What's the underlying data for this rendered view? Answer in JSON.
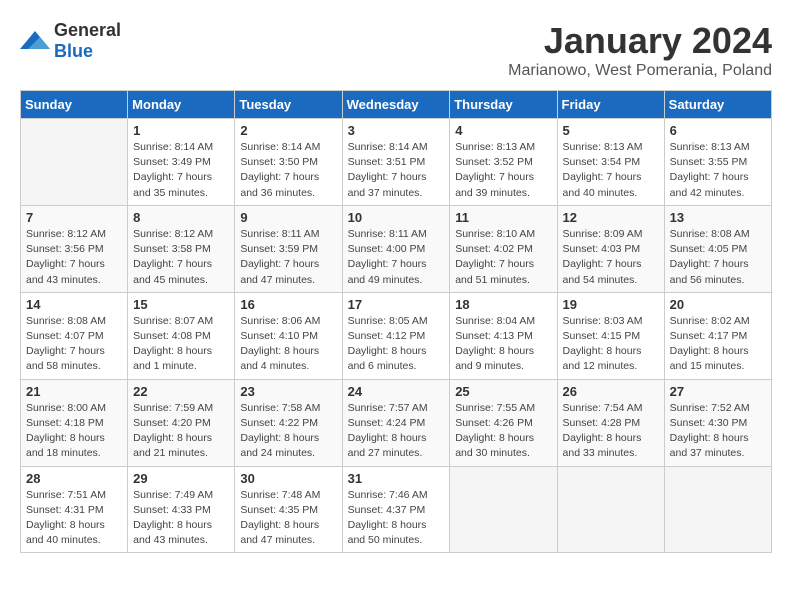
{
  "header": {
    "logo_general": "General",
    "logo_blue": "Blue",
    "month": "January 2024",
    "location": "Marianowo, West Pomerania, Poland"
  },
  "weekdays": [
    "Sunday",
    "Monday",
    "Tuesday",
    "Wednesday",
    "Thursday",
    "Friday",
    "Saturday"
  ],
  "weeks": [
    [
      {
        "day": "",
        "info": ""
      },
      {
        "day": "1",
        "info": "Sunrise: 8:14 AM\nSunset: 3:49 PM\nDaylight: 7 hours\nand 35 minutes."
      },
      {
        "day": "2",
        "info": "Sunrise: 8:14 AM\nSunset: 3:50 PM\nDaylight: 7 hours\nand 36 minutes."
      },
      {
        "day": "3",
        "info": "Sunrise: 8:14 AM\nSunset: 3:51 PM\nDaylight: 7 hours\nand 37 minutes."
      },
      {
        "day": "4",
        "info": "Sunrise: 8:13 AM\nSunset: 3:52 PM\nDaylight: 7 hours\nand 39 minutes."
      },
      {
        "day": "5",
        "info": "Sunrise: 8:13 AM\nSunset: 3:54 PM\nDaylight: 7 hours\nand 40 minutes."
      },
      {
        "day": "6",
        "info": "Sunrise: 8:13 AM\nSunset: 3:55 PM\nDaylight: 7 hours\nand 42 minutes."
      }
    ],
    [
      {
        "day": "7",
        "info": "Sunrise: 8:12 AM\nSunset: 3:56 PM\nDaylight: 7 hours\nand 43 minutes."
      },
      {
        "day": "8",
        "info": "Sunrise: 8:12 AM\nSunset: 3:58 PM\nDaylight: 7 hours\nand 45 minutes."
      },
      {
        "day": "9",
        "info": "Sunrise: 8:11 AM\nSunset: 3:59 PM\nDaylight: 7 hours\nand 47 minutes."
      },
      {
        "day": "10",
        "info": "Sunrise: 8:11 AM\nSunset: 4:00 PM\nDaylight: 7 hours\nand 49 minutes."
      },
      {
        "day": "11",
        "info": "Sunrise: 8:10 AM\nSunset: 4:02 PM\nDaylight: 7 hours\nand 51 minutes."
      },
      {
        "day": "12",
        "info": "Sunrise: 8:09 AM\nSunset: 4:03 PM\nDaylight: 7 hours\nand 54 minutes."
      },
      {
        "day": "13",
        "info": "Sunrise: 8:08 AM\nSunset: 4:05 PM\nDaylight: 7 hours\nand 56 minutes."
      }
    ],
    [
      {
        "day": "14",
        "info": "Sunrise: 8:08 AM\nSunset: 4:07 PM\nDaylight: 7 hours\nand 58 minutes."
      },
      {
        "day": "15",
        "info": "Sunrise: 8:07 AM\nSunset: 4:08 PM\nDaylight: 8 hours\nand 1 minute."
      },
      {
        "day": "16",
        "info": "Sunrise: 8:06 AM\nSunset: 4:10 PM\nDaylight: 8 hours\nand 4 minutes."
      },
      {
        "day": "17",
        "info": "Sunrise: 8:05 AM\nSunset: 4:12 PM\nDaylight: 8 hours\nand 6 minutes."
      },
      {
        "day": "18",
        "info": "Sunrise: 8:04 AM\nSunset: 4:13 PM\nDaylight: 8 hours\nand 9 minutes."
      },
      {
        "day": "19",
        "info": "Sunrise: 8:03 AM\nSunset: 4:15 PM\nDaylight: 8 hours\nand 12 minutes."
      },
      {
        "day": "20",
        "info": "Sunrise: 8:02 AM\nSunset: 4:17 PM\nDaylight: 8 hours\nand 15 minutes."
      }
    ],
    [
      {
        "day": "21",
        "info": "Sunrise: 8:00 AM\nSunset: 4:18 PM\nDaylight: 8 hours\nand 18 minutes."
      },
      {
        "day": "22",
        "info": "Sunrise: 7:59 AM\nSunset: 4:20 PM\nDaylight: 8 hours\nand 21 minutes."
      },
      {
        "day": "23",
        "info": "Sunrise: 7:58 AM\nSunset: 4:22 PM\nDaylight: 8 hours\nand 24 minutes."
      },
      {
        "day": "24",
        "info": "Sunrise: 7:57 AM\nSunset: 4:24 PM\nDaylight: 8 hours\nand 27 minutes."
      },
      {
        "day": "25",
        "info": "Sunrise: 7:55 AM\nSunset: 4:26 PM\nDaylight: 8 hours\nand 30 minutes."
      },
      {
        "day": "26",
        "info": "Sunrise: 7:54 AM\nSunset: 4:28 PM\nDaylight: 8 hours\nand 33 minutes."
      },
      {
        "day": "27",
        "info": "Sunrise: 7:52 AM\nSunset: 4:30 PM\nDaylight: 8 hours\nand 37 minutes."
      }
    ],
    [
      {
        "day": "28",
        "info": "Sunrise: 7:51 AM\nSunset: 4:31 PM\nDaylight: 8 hours\nand 40 minutes."
      },
      {
        "day": "29",
        "info": "Sunrise: 7:49 AM\nSunset: 4:33 PM\nDaylight: 8 hours\nand 43 minutes."
      },
      {
        "day": "30",
        "info": "Sunrise: 7:48 AM\nSunset: 4:35 PM\nDaylight: 8 hours\nand 47 minutes."
      },
      {
        "day": "31",
        "info": "Sunrise: 7:46 AM\nSunset: 4:37 PM\nDaylight: 8 hours\nand 50 minutes."
      },
      {
        "day": "",
        "info": ""
      },
      {
        "day": "",
        "info": ""
      },
      {
        "day": "",
        "info": ""
      }
    ]
  ]
}
